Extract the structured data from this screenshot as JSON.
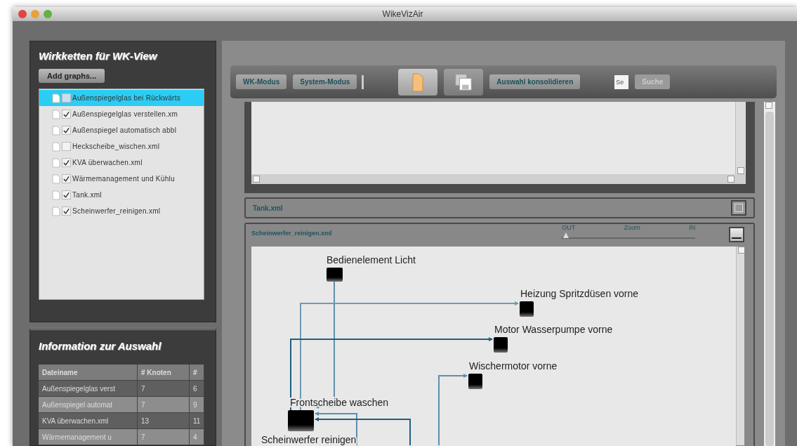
{
  "window": {
    "title": "WikeVizAir"
  },
  "graph_list": {
    "title": "Wirkketten für WK-View",
    "add_button": "Add graphs...",
    "items": [
      {
        "label": "Außenspiegelglas bei Rückwärts",
        "checked": false,
        "selected": true
      },
      {
        "label": "Außenspiegelglas verstellen.xm",
        "checked": true,
        "selected": false
      },
      {
        "label": "Außenspiegel automatisch abbl",
        "checked": true,
        "selected": false
      },
      {
        "label": "Heckscheibe_wischen.xml",
        "checked": false,
        "selected": false
      },
      {
        "label": "KVA überwachen.xml",
        "checked": true,
        "selected": false
      },
      {
        "label": "Wärmemanagement und Kühlu",
        "checked": true,
        "selected": false
      },
      {
        "label": "Tank.xml",
        "checked": true,
        "selected": false
      },
      {
        "label": "Scheinwerfer_reinigen.xml",
        "checked": true,
        "selected": false
      }
    ]
  },
  "info": {
    "title": "Information zur Auswahl",
    "columns": [
      "Dateiname",
      "# Knoten",
      "#"
    ],
    "rows": [
      [
        "Außenspiegelglas verst",
        "7",
        "6"
      ],
      [
        "Außenspiegel automat",
        "7",
        "9"
      ],
      [
        "KVA überwachen.xml",
        "13",
        "11"
      ],
      [
        "Wärmemanagement u",
        "7",
        "4"
      ]
    ]
  },
  "toolbar": {
    "items": [
      {
        "kind": "text",
        "label": "WK-Modus"
      },
      {
        "kind": "text",
        "label": "System-Modus"
      },
      {
        "kind": "separator"
      },
      {
        "kind": "folder"
      },
      {
        "kind": "save"
      },
      {
        "kind": "text",
        "label": "Auswahl konsolidieren"
      }
    ],
    "search": {
      "value": "Se",
      "button": "Suche",
      "disabled": true
    }
  },
  "collapsed_panel": {
    "title": "Tank.xml"
  },
  "graph_panel": {
    "title": "Scheinwerfer_reinigen.xml",
    "zoom": {
      "out_label": "OUT",
      "label": "Zoom",
      "in_label": "IN",
      "level": 0.03
    },
    "nodes": [
      {
        "label": "Bedienelement Licht"
      },
      {
        "label": "Heizung Spritzdüsen vorne"
      },
      {
        "label": "Motor Wasserpumpe vorne"
      },
      {
        "label": "Wischermotor vorne"
      },
      {
        "label": "Frontscheibe waschen"
      },
      {
        "label": "Scheinwerfer reinigen"
      }
    ]
  }
}
